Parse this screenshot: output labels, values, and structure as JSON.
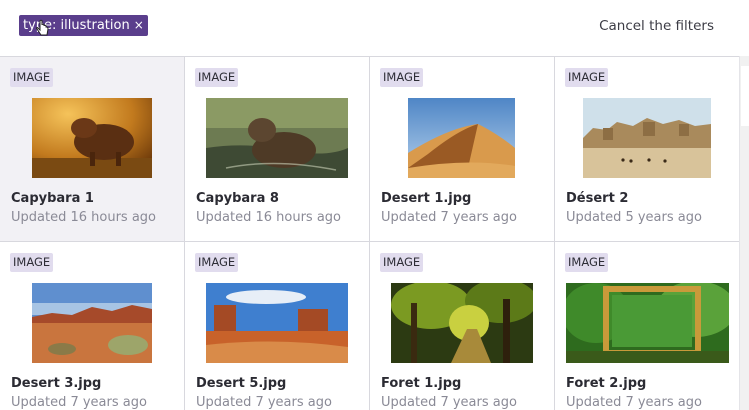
{
  "filter": {
    "chip_label": "type: illustration",
    "remove_icon": "×",
    "cancel_label": "Cancel the filters"
  },
  "cards": [
    {
      "badge": "IMAGE",
      "title": "Capybara 1",
      "updated": "Updated 16 hours ago"
    },
    {
      "badge": "IMAGE",
      "title": "Capybara 8",
      "updated": "Updated 16 hours ago"
    },
    {
      "badge": "IMAGE",
      "title": "Desert 1.jpg",
      "updated": "Updated 7 years ago"
    },
    {
      "badge": "IMAGE",
      "title": "Désert 2",
      "updated": "Updated 5 years ago"
    },
    {
      "badge": "IMAGE",
      "title": "Desert 3.jpg",
      "updated": "Updated 7 years ago"
    },
    {
      "badge": "IMAGE",
      "title": "Desert 5.jpg",
      "updated": "Updated 7 years ago"
    },
    {
      "badge": "IMAGE",
      "title": "Foret 1.jpg",
      "updated": "Updated 7 years ago"
    },
    {
      "badge": "IMAGE",
      "title": "Foret 2.jpg",
      "updated": "Updated 7 years ago"
    }
  ],
  "colors": {
    "accent": "#5a3e8c",
    "badge_bg": "#e1dcee",
    "selected_bg": "#f2f1f5"
  }
}
